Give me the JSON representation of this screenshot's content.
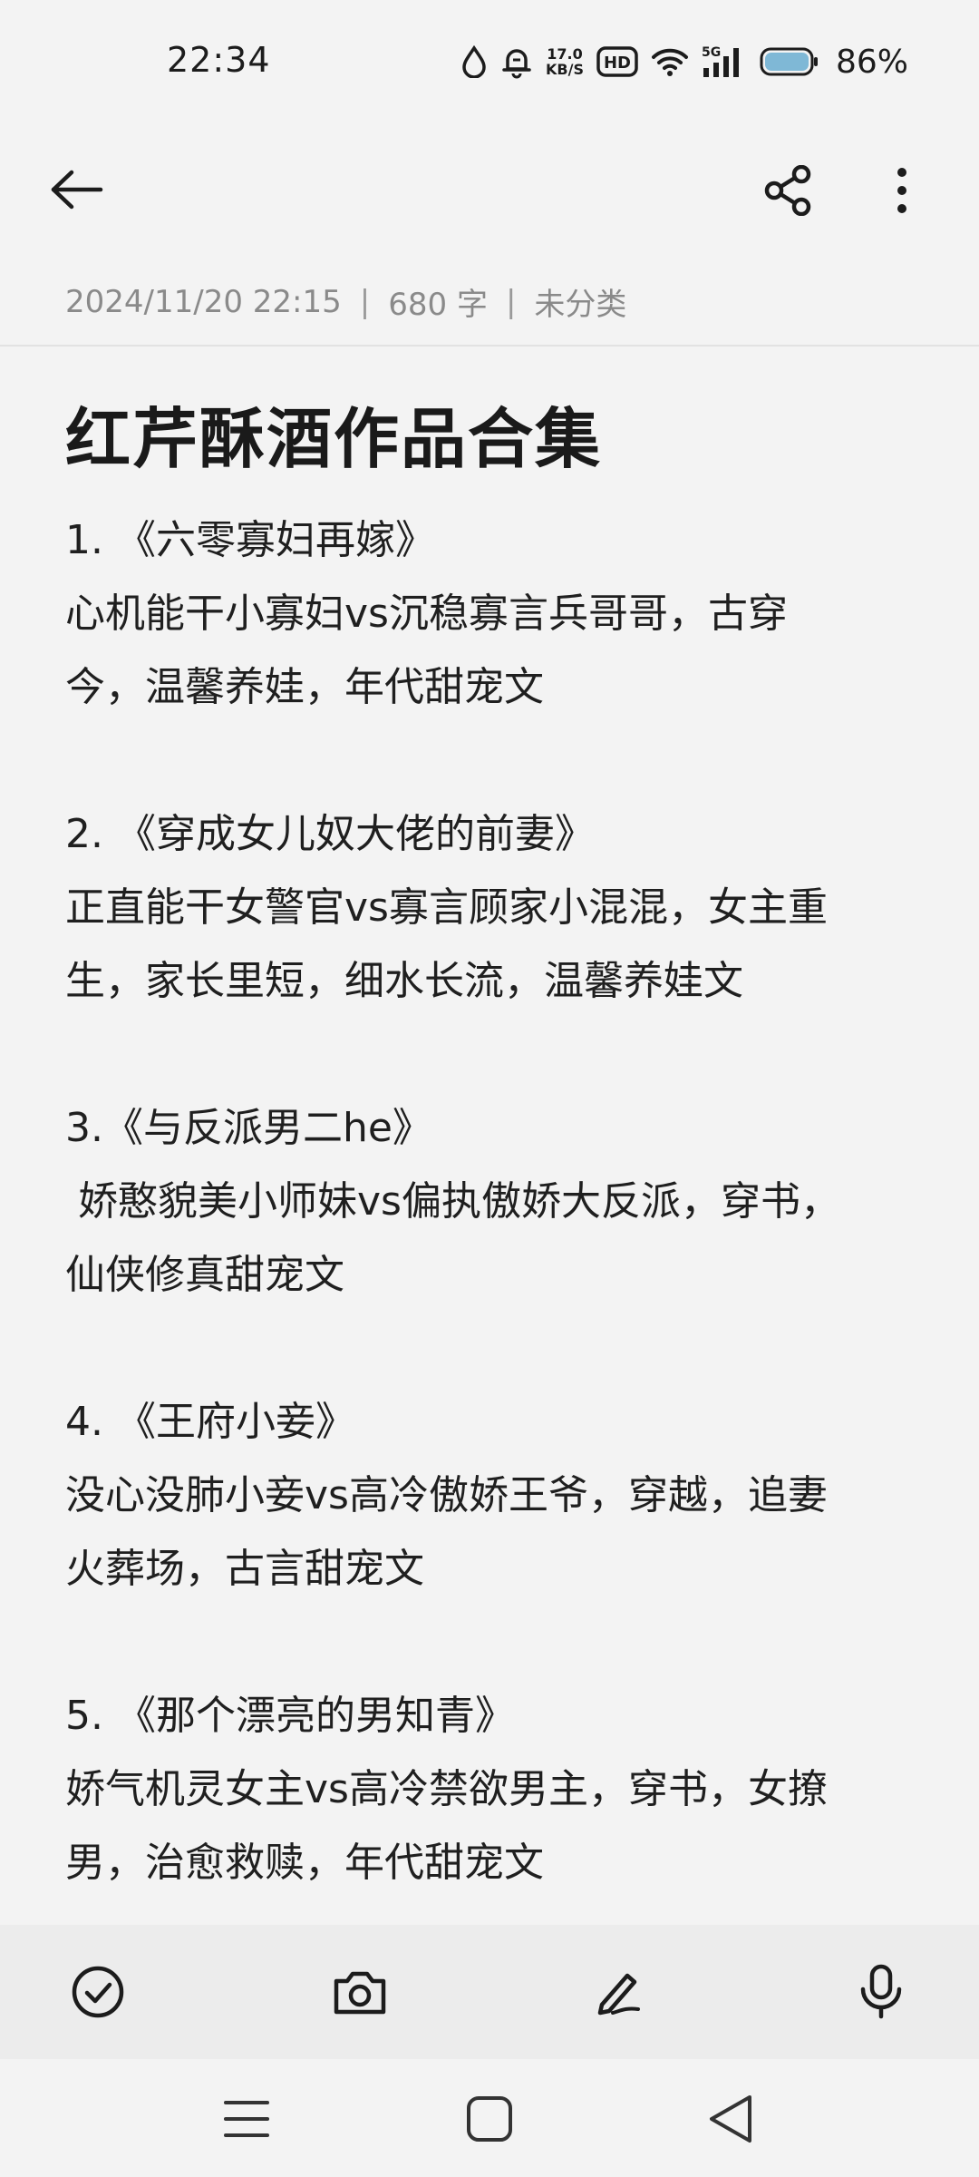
{
  "status_bar": {
    "time": "22:34",
    "net_speed_value": "17.0",
    "net_speed_unit": "KB/S",
    "hd_label": "HD",
    "signal_label": "5G",
    "battery_percent": "86%",
    "icons": [
      "water-drop-icon",
      "alarm-icon",
      "hd-icon",
      "wifi-icon",
      "signal-icon",
      "battery-icon"
    ]
  },
  "top_bar": {
    "icons": [
      "back-arrow-icon",
      "share-icon",
      "more-vert-icon"
    ]
  },
  "meta": {
    "date": "2024/11/20 22:15",
    "word_count": "680 字",
    "category": "未分类",
    "separator": "|"
  },
  "note": {
    "title": "红芹酥酒作品合集",
    "entries": [
      {
        "heading": "1. 《六零寡妇再嫁》",
        "line1": "心机能干小寡妇vs沉稳寡言兵哥哥，古穿",
        "line2": "今，温馨养娃，年代甜宠文"
      },
      {
        "heading": "2. 《穿成女儿奴大佬的前妻》",
        "line1": "正直能干女警官vs寡言顾家小混混，女主重",
        "line2": "生，家长里短，细水长流，温馨养娃文"
      },
      {
        "heading": "3.《与反派男二he》",
        "line1": " 娇憨貌美小师妹vs偏执傲娇大反派，穿书，",
        "line2": "仙侠修真甜宠文"
      },
      {
        "heading": "4. 《王府小妾》",
        "line1": "没心没肺小妾vs高冷傲娇王爷，穿越，追妻",
        "line2": "火葬场，古言甜宠文"
      },
      {
        "heading": "5. 《那个漂亮的男知青》",
        "line1": "娇气机灵女主vs高冷禁欲男主，穿书，女撩",
        "line2": "男，治愈救赎，年代甜宠文"
      }
    ]
  },
  "toolbar": {
    "icons": [
      "checklist-icon",
      "camera-icon",
      "pen-icon",
      "microphone-icon"
    ]
  },
  "nav_bar": {
    "icons": [
      "menu-icon",
      "home-icon",
      "back-triangle-icon"
    ]
  },
  "colors": {
    "background": "#f3f3f3",
    "text": "#1f1f1f",
    "meta_text": "#8a8a8a",
    "toolbar_bg": "#ececec",
    "battery_fill": "#7fb8d6"
  }
}
